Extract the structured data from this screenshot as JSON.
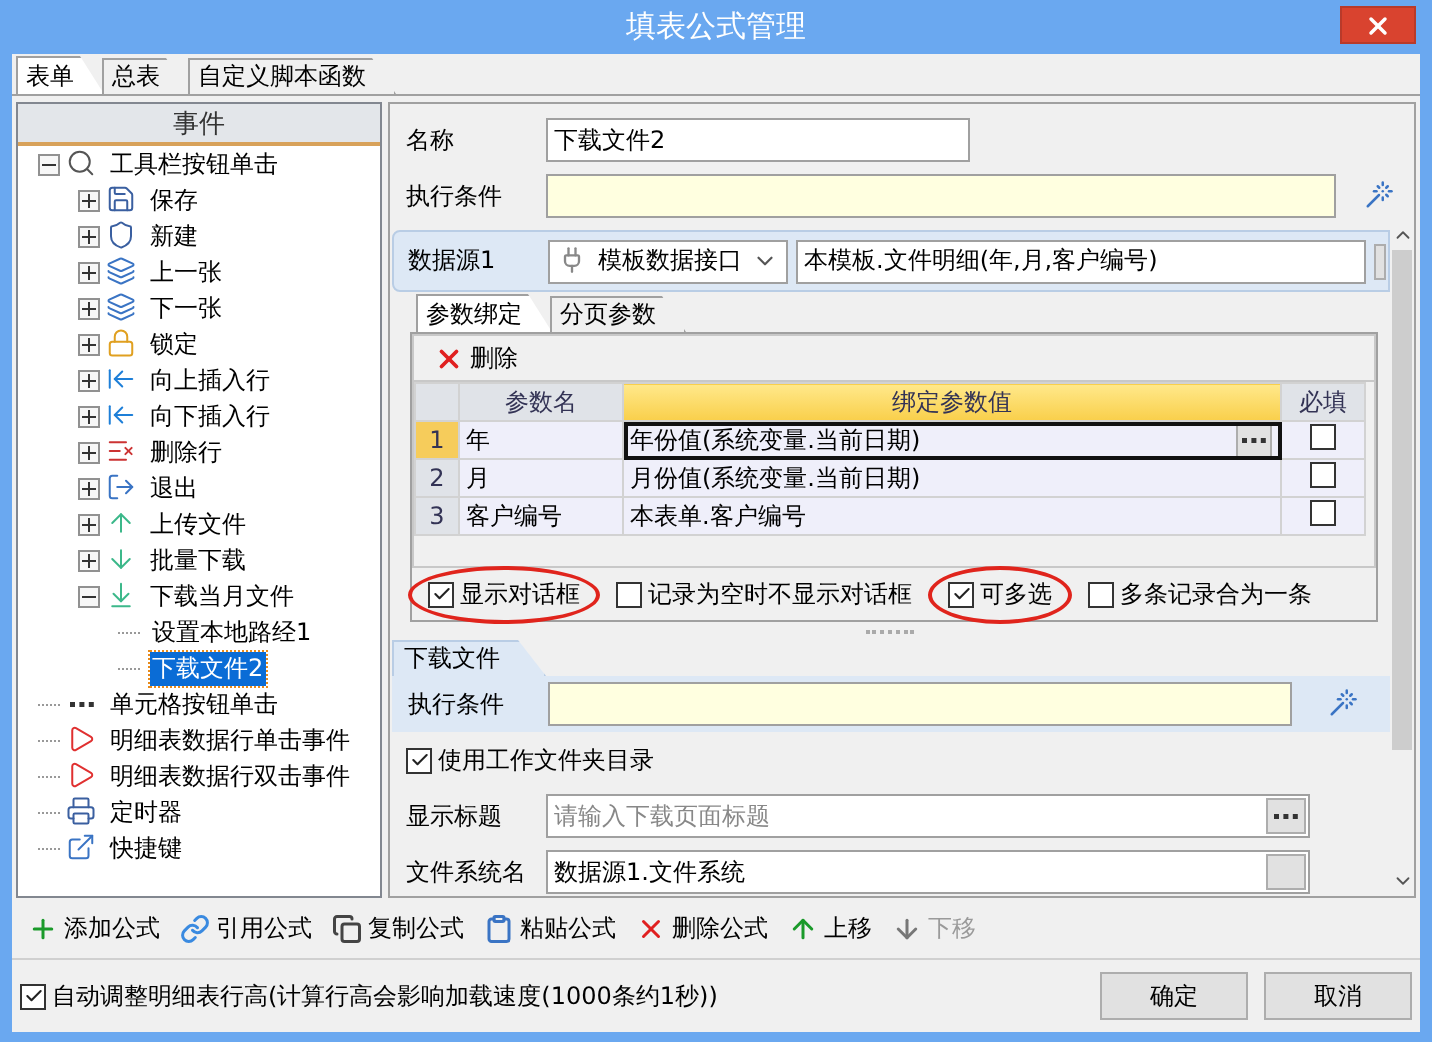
{
  "window": {
    "title": "填表公式管理"
  },
  "tabs": [
    {
      "label": "表单",
      "selected": true
    },
    {
      "label": "总表",
      "selected": false
    },
    {
      "label": "自定义脚本函数",
      "selected": false
    }
  ],
  "events_panel": {
    "header": "事件",
    "tree": [
      {
        "label": "工具栏按钮单击",
        "kind": "tool",
        "expanded": true,
        "selected": false,
        "children": [
          {
            "label": "保存",
            "kind": "save",
            "expanded": false,
            "selected": false
          },
          {
            "label": "新建",
            "kind": "new",
            "expanded": false,
            "selected": false
          },
          {
            "label": "上一张",
            "kind": "layers",
            "expanded": false,
            "selected": false
          },
          {
            "label": "下一张",
            "kind": "layers",
            "expanded": false,
            "selected": false
          },
          {
            "label": "锁定",
            "kind": "lock",
            "expanded": false,
            "selected": false
          },
          {
            "label": "向上插入行",
            "kind": "insert",
            "expanded": false,
            "selected": false
          },
          {
            "label": "向下插入行",
            "kind": "insert",
            "expanded": false,
            "selected": false
          },
          {
            "label": "删除行",
            "kind": "delete-row",
            "expanded": false,
            "selected": false
          },
          {
            "label": "退出",
            "kind": "exit",
            "expanded": false,
            "selected": false
          },
          {
            "label": "上传文件",
            "kind": "upload",
            "expanded": false,
            "selected": false
          },
          {
            "label": "批量下载",
            "kind": "download",
            "expanded": false,
            "selected": false
          },
          {
            "label": "下载当月文件",
            "kind": "download-line",
            "expanded": true,
            "selected": false,
            "children": [
              {
                "label": "设置本地路经1",
                "selected": false
              },
              {
                "label": "下载文件2",
                "selected": true
              }
            ]
          }
        ]
      },
      {
        "label": "单元格按钮单击",
        "kind": "dots",
        "selected": false
      },
      {
        "label": "明细表数据行单击事件",
        "kind": "flag",
        "selected": false
      },
      {
        "label": "明细表数据行双击事件",
        "kind": "flag",
        "selected": false
      },
      {
        "label": "定时器",
        "kind": "timer",
        "selected": false
      },
      {
        "label": "快捷键",
        "kind": "shortcut",
        "selected": false
      }
    ]
  },
  "form": {
    "name_label": "名称",
    "name_value": "下载文件2",
    "condition_label": "执行条件",
    "datasource": {
      "label": "数据源1",
      "type": "模板数据接口",
      "value": "本模板.文件明细(年,月,客户编号)"
    },
    "param_tabs": [
      {
        "label": "参数绑定",
        "selected": true
      },
      {
        "label": "分页参数",
        "selected": false
      }
    ],
    "delete_label": "删除",
    "grid": {
      "columns": [
        {
          "label": "参数名",
          "selected": false
        },
        {
          "label": "绑定参数值",
          "selected": true
        },
        {
          "label": "必填",
          "selected": false
        }
      ],
      "rows": [
        {
          "number": "1",
          "name": "年",
          "value": "年份值(系统变量.当前日期)",
          "required": false,
          "selected": true
        },
        {
          "number": "2",
          "name": "月",
          "value": "月份值(系统变量.当前日期)",
          "required": false,
          "selected": false
        },
        {
          "number": "3",
          "name": "客户编号",
          "value": "本表单.客户编号",
          "required": false,
          "selected": false
        }
      ]
    },
    "options": [
      {
        "label": "显示对话框",
        "checked": true,
        "circled": true
      },
      {
        "label": "记录为空时不显示对话框",
        "checked": false,
        "circled": false
      },
      {
        "label": "可多选",
        "checked": true,
        "circled": true
      },
      {
        "label": "多条记录合为一条",
        "checked": false,
        "circled": false
      }
    ],
    "action": {
      "tab": "下载文件",
      "condition_label": "执行条件",
      "use_workdir": {
        "label": "使用工作文件夹目录",
        "checked": true
      },
      "title_label": "显示标题",
      "title_placeholder": "请输入下载页面标题",
      "fs_label": "文件系统名",
      "fs_value": "数据源1.文件系统"
    }
  },
  "toolbar": [
    {
      "label": "添加公式",
      "kind": "add",
      "disabled": false
    },
    {
      "label": "引用公式",
      "kind": "link",
      "disabled": false
    },
    {
      "label": "复制公式",
      "kind": "copy",
      "disabled": false
    },
    {
      "label": "粘贴公式",
      "kind": "paste",
      "disabled": false
    },
    {
      "label": "删除公式",
      "kind": "delete",
      "disabled": false
    },
    {
      "label": "上移",
      "kind": "up",
      "disabled": false
    },
    {
      "label": "下移",
      "kind": "down",
      "disabled": true
    }
  ],
  "auto_height": {
    "label": "自动调整明细表行高(计算行高会影响加载速度(1000条约1秒))",
    "checked": true
  },
  "buttons": [
    "确定",
    "取消"
  ]
}
